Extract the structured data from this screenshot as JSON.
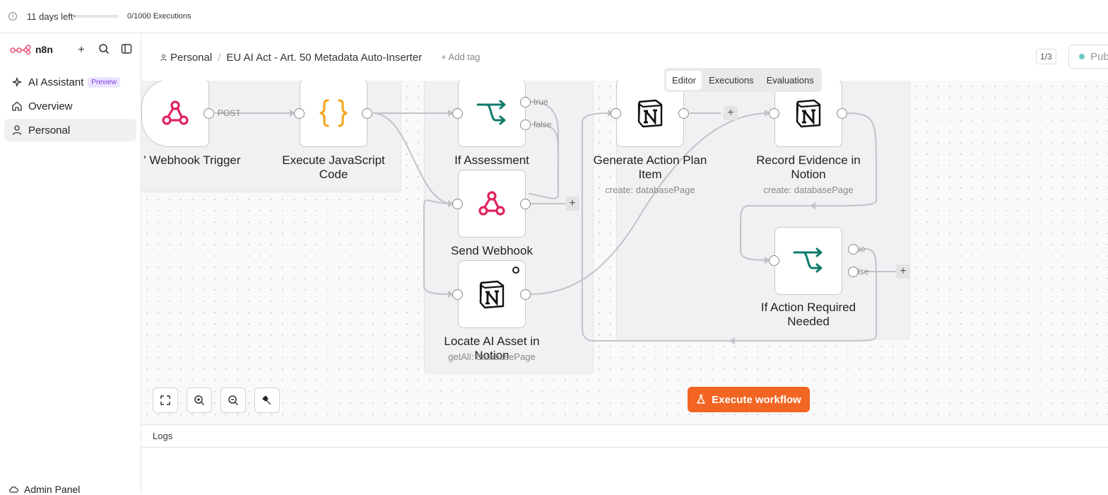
{
  "topbar": {
    "trial_text": "11 days left",
    "trial_progress": 0.05,
    "executions": "0/1000 Executions"
  },
  "sidebar": {
    "brand": "n8n",
    "items": [
      {
        "label": "AI Assistant",
        "badge": "Preview",
        "icon": "sparkles-icon"
      },
      {
        "label": "Overview",
        "icon": "home-icon"
      },
      {
        "label": "Personal",
        "icon": "user-icon"
      }
    ],
    "admin": "Admin Panel"
  },
  "header": {
    "project": "Personal",
    "workflow_name": "EU AI Act - Art. 50 Metadata Auto-Inserter",
    "add_tag": "+ Add tag",
    "pager": "1/3",
    "publish": "Pub"
  },
  "tabs": [
    "Editor",
    "Executions",
    "Evaluations"
  ],
  "nodes": [
    {
      "label": "Webhook Trigger",
      "partial": "'",
      "sub": ""
    },
    {
      "label": "Execute JavaScript Code",
      "sub": ""
    },
    {
      "label": "If Assessment Applicable",
      "sub": ""
    },
    {
      "label": "Send Webhook",
      "sub": ""
    },
    {
      "label": "Locate AI Asset in Notion",
      "sub": "getAll: databasePage"
    },
    {
      "label": "Generate Action Plan Item",
      "sub": "create: databasePage"
    },
    {
      "label": "Record Evidence in Notion",
      "sub": "create: databasePage"
    },
    {
      "label": "If Action Required Needed",
      "sub": ""
    }
  ],
  "edge_labels": {
    "post": "POST",
    "true": "true",
    "false": "false"
  },
  "execute_button": "Execute workflow",
  "logs": {
    "title": "Logs"
  },
  "colors": {
    "accent": "#f26522",
    "webhook": "#e0245e",
    "code": "#f5a623",
    "if": "#0f7a6c"
  }
}
